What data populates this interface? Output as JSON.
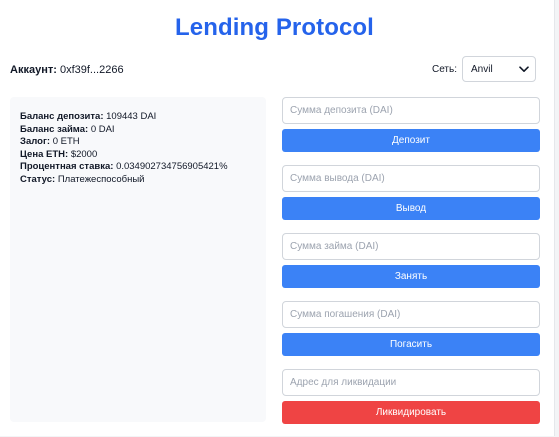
{
  "app": {
    "title": "Lending Protocol"
  },
  "account": {
    "label": "Аккаунт:",
    "value": "0xf39f...2266"
  },
  "network": {
    "label": "Сеть:",
    "selected": "Anvil"
  },
  "info": [
    {
      "label": "Баланс депозита:",
      "value": "109443 DAI"
    },
    {
      "label": "Баланс займа:",
      "value": "0 DAI"
    },
    {
      "label": "Залог:",
      "value": "0 ETH"
    },
    {
      "label": "Цена ETH:",
      "value": "$2000"
    },
    {
      "label": "Процентная ставка:",
      "value": "0.034902734756905421%"
    },
    {
      "label": "Статус:",
      "value": "Платежеспособный"
    }
  ],
  "forms": {
    "deposit": {
      "placeholder": "Сумма депозита (DAI)",
      "button": "Депозит"
    },
    "withdraw": {
      "placeholder": "Сумма вывода (DAI)",
      "button": "Вывод"
    },
    "borrow": {
      "placeholder": "Сумма займа (DAI)",
      "button": "Занять"
    },
    "repay": {
      "placeholder": "Сумма погашения (DAI)",
      "button": "Погасить"
    },
    "liquidate": {
      "placeholder": "Адрес для ликвидации",
      "button": "Ликвидировать"
    }
  },
  "colors": {
    "accent": "#2563eb",
    "primary_button": "#3b82f6",
    "danger_button": "#ef4444"
  }
}
